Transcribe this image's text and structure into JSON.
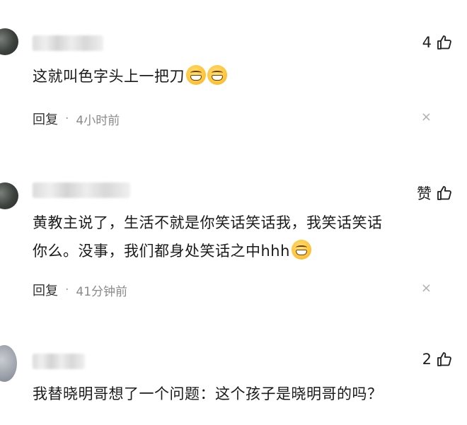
{
  "comments": [
    {
      "username": "",
      "likes": "4",
      "text": "这就叫色字头上一把刀",
      "emoji": "grin-emoji",
      "reply_label": "回复",
      "time": "4小时前",
      "close": "×"
    },
    {
      "username": "",
      "likes": "赞",
      "text_line1": "黄教主说了，生活不就是你笑话笑话我，我笑话笑话",
      "text_line2": "你么。没事，我们都身处笑话之中hhh",
      "emoji": "grin-emoji",
      "reply_label": "回复",
      "time": "41分钟前",
      "close": "×"
    },
    {
      "username": "",
      "likes": "2",
      "text": "我替晓明哥想了一个问题：这个孩子是晓明哥的吗？"
    }
  ],
  "icons": {
    "like": "thumbs-up-icon"
  },
  "colors": {
    "text": "#1a1a1a",
    "meta": "#8a8a8a",
    "close": "#b0b0b0"
  }
}
